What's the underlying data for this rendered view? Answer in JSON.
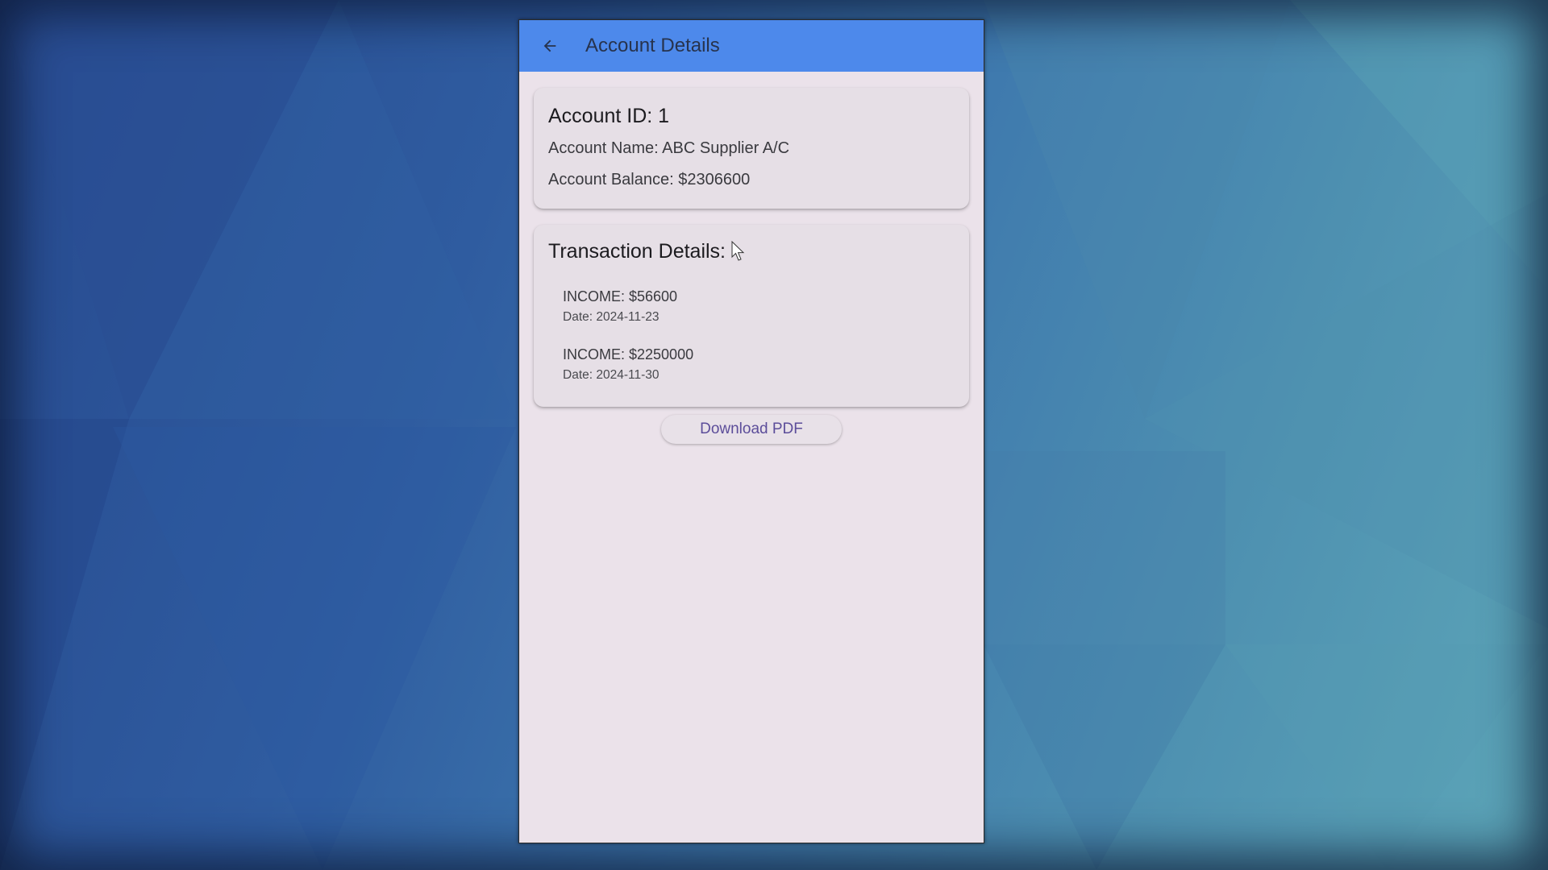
{
  "app": {
    "title": "Account Details"
  },
  "icons": {
    "back": "arrow-left-icon"
  },
  "colors": {
    "appbar": "#4d89eb",
    "surface": "#ebe2ea",
    "card": "#e6dfe6",
    "button_text": "#5c4d9a"
  },
  "account": {
    "id_label": "Account ID: 1",
    "name_label": "Account Name: ABC Supplier A/C",
    "balance_label": "Account Balance: $2306600"
  },
  "transactions": {
    "heading": "Transaction Details:",
    "items": [
      {
        "amount": "INCOME: $56600",
        "date": "Date: 2024-11-23"
      },
      {
        "amount": "INCOME: $2250000",
        "date": "Date: 2024-11-30"
      }
    ]
  },
  "actions": {
    "download_pdf": "Download PDF"
  }
}
